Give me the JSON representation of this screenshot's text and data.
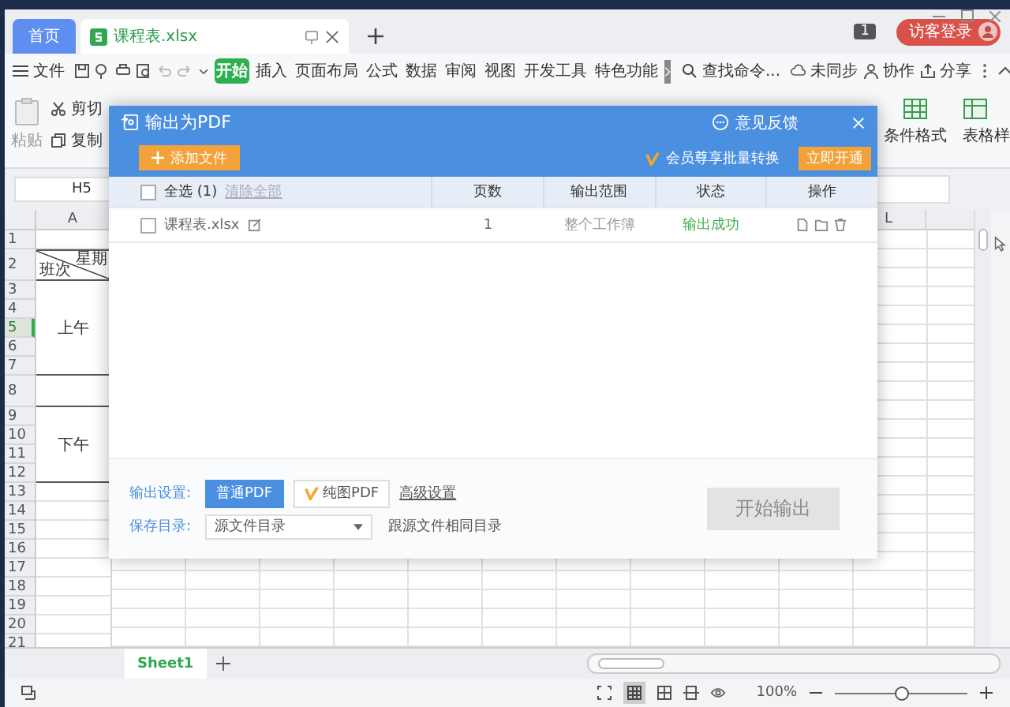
{
  "window": {
    "tabs": [
      {
        "label": "首页",
        "selected": false,
        "kind": "home"
      },
      {
        "label": "课程表.xlsx",
        "selected": true,
        "kind": "file"
      }
    ],
    "window_count": "1",
    "login_button": "访客登录"
  },
  "menu": {
    "file": "文件",
    "items": [
      {
        "label": "开始",
        "selected": true
      },
      {
        "label": "插入",
        "selected": false
      },
      {
        "label": "页面布局",
        "selected": false
      },
      {
        "label": "公式",
        "selected": false
      },
      {
        "label": "数据",
        "selected": false
      },
      {
        "label": "审阅",
        "selected": false
      },
      {
        "label": "视图",
        "selected": false
      },
      {
        "label": "开发工具",
        "selected": false
      },
      {
        "label": "特色功能",
        "selected": false
      }
    ],
    "search": "查找命令...",
    "sync": "未同步",
    "collaborate": "协作",
    "share": "分享"
  },
  "ribbon": {
    "cut": "剪切",
    "copy": "复制",
    "paste": "粘贴",
    "conditional_format": "条件格式",
    "table_style": "表格样"
  },
  "sheet": {
    "name_box": "H5",
    "columns": [
      "A",
      "L"
    ],
    "rows": [
      {
        "label": "1",
        "selected": false
      },
      {
        "label": "2",
        "selected": false
      },
      {
        "label": "3",
        "selected": false
      },
      {
        "label": "4",
        "selected": false
      },
      {
        "label": "5",
        "selected": true
      },
      {
        "label": "6",
        "selected": false
      },
      {
        "label": "7",
        "selected": false
      },
      {
        "label": "8",
        "selected": false
      },
      {
        "label": "9",
        "selected": false
      },
      {
        "label": "10",
        "selected": false
      },
      {
        "label": "11",
        "selected": false
      },
      {
        "label": "12",
        "selected": false
      },
      {
        "label": "13",
        "selected": false
      },
      {
        "label": "14",
        "selected": false
      },
      {
        "label": "15",
        "selected": false
      },
      {
        "label": "16",
        "selected": false
      },
      {
        "label": "17",
        "selected": false
      },
      {
        "label": "18",
        "selected": false
      },
      {
        "label": "19",
        "selected": false
      },
      {
        "label": "20",
        "selected": false
      },
      {
        "label": "21",
        "selected": false
      }
    ],
    "header_cell": {
      "top": "星期",
      "bottom": "班次"
    },
    "morning": "上午",
    "afternoon": "下午",
    "sheet_tabs": [
      {
        "label": "Sheet1",
        "selected": true
      }
    ],
    "zoom": "100%",
    "zoom_slider": {
      "level": 0.5
    }
  },
  "dialog": {
    "title": "输出为PDF",
    "feedback": "意见反馈",
    "add_button": "添加文件",
    "promo": "会员尊享批量转换",
    "promo_button": "立即开通",
    "select_all": {
      "label": "全选 (1)",
      "checked": false
    },
    "clear_all": "清除全部",
    "columns": [
      "页数",
      "输出范围",
      "状态",
      "操作"
    ],
    "files": [
      {
        "name": "课程表.xlsx",
        "checked": false,
        "pages": "1",
        "range": "整个工作簿",
        "status": "输出成功"
      }
    ],
    "output_label": "输出设置:",
    "output_options": [
      {
        "label": "普通PDF",
        "selected": true,
        "premium": false
      },
      {
        "label": "纯图PDF",
        "selected": false,
        "premium": true
      }
    ],
    "advanced": "高级设置",
    "save_label": "保存目录:",
    "save_dir": "源文件目录",
    "save_note": "跟源文件相同目录",
    "start_button": {
      "label": "开始输出",
      "disabled": true
    }
  }
}
